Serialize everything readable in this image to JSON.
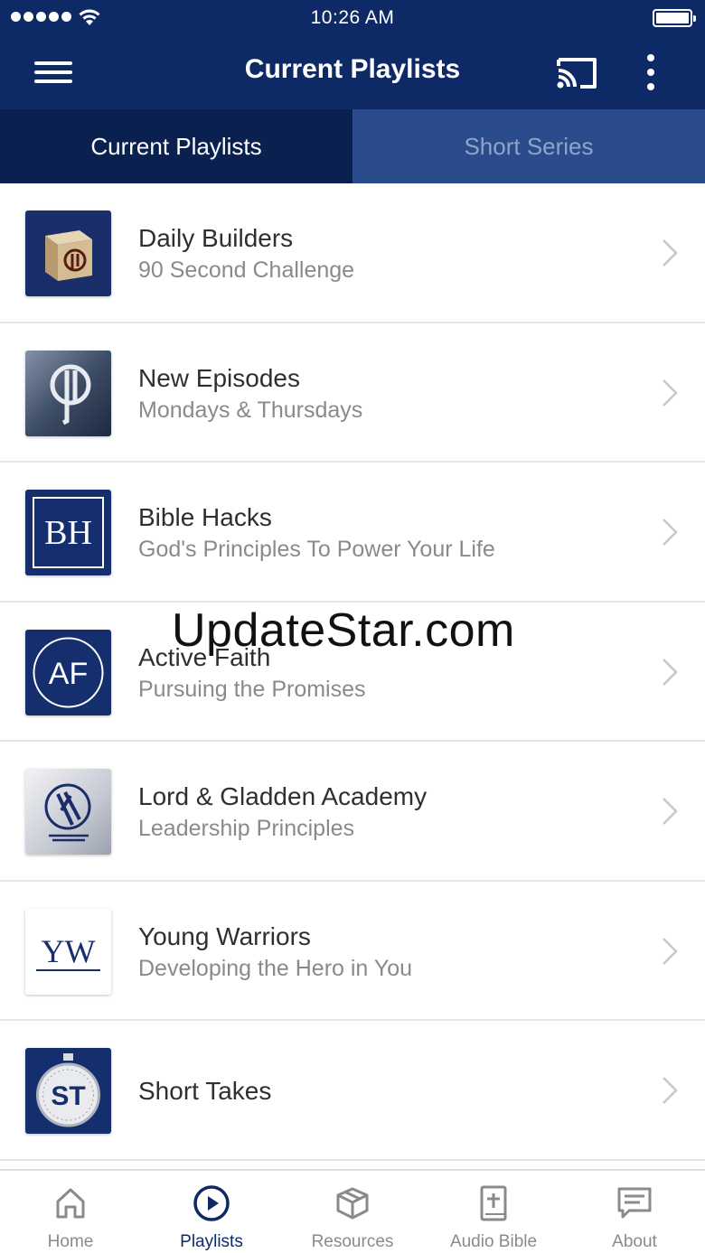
{
  "status_bar": {
    "time": "10:26 AM",
    "signal_icon": "signal-dots-icon",
    "wifi_icon": "wifi-icon",
    "battery_icon": "battery-icon"
  },
  "app_bar": {
    "title": "Current Playlists",
    "menu_icon": "hamburger-menu-icon",
    "cast_icon": "cast-icon",
    "more_icon": "more-vertical-icon"
  },
  "tabs": [
    {
      "label": "Current Playlists",
      "active": true
    },
    {
      "label": "Short Series",
      "active": false
    }
  ],
  "playlists": [
    {
      "title": "Daily Builders",
      "subtitle": "90 Second Challenge",
      "thumb_icon": "cube-logo-icon"
    },
    {
      "title": "New Episodes",
      "subtitle": "Mondays & Thursdays",
      "thumb_icon": "episodes-logo-icon"
    },
    {
      "title": "Bible Hacks",
      "subtitle": "God's Principles To Power Your Life",
      "thumb_icon": "bh-logo-icon",
      "thumb_text": "BH"
    },
    {
      "title": "Active Faith",
      "subtitle": "Pursuing the Promises",
      "thumb_icon": "af-logo-icon",
      "thumb_text": "AF"
    },
    {
      "title": "Lord & Gladden Academy",
      "subtitle": "Leadership Principles",
      "thumb_icon": "academy-logo-icon"
    },
    {
      "title": "Young Warriors",
      "subtitle": "Developing the Hero in You",
      "thumb_icon": "yw-logo-icon",
      "thumb_text": "YW"
    },
    {
      "title": "Short Takes",
      "subtitle": "",
      "thumb_icon": "stopwatch-logo-icon",
      "thumb_text": "ST"
    }
  ],
  "watermark": "UpdateStar.com",
  "bottom_nav": [
    {
      "label": "Home",
      "icon": "home-icon",
      "active": false
    },
    {
      "label": "Playlists",
      "icon": "play-circle-icon",
      "active": true
    },
    {
      "label": "Resources",
      "icon": "box-icon",
      "active": false
    },
    {
      "label": "Audio Bible",
      "icon": "bible-icon",
      "active": false
    },
    {
      "label": "About",
      "icon": "message-icon",
      "active": false
    }
  ],
  "colors": {
    "primary": "#0e2a66",
    "tab_active": "#0a2150",
    "tab_inactive": "#2a4c8c",
    "nav_inactive": "#8a8a8a"
  }
}
